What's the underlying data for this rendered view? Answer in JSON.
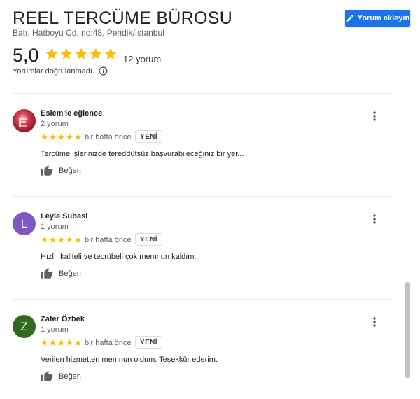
{
  "business": {
    "name": "REEL TERCÜME BÜROSU",
    "address": "Batı, Hatboyu Cd. no:48, Pendik/İstanbul",
    "write_review_label": "Yorum ekleyin",
    "rating": "5,0",
    "rating_value": 5,
    "review_count": "12 yorum",
    "unverified_note": "Yorumlar doğrulanmadı."
  },
  "colors": {
    "accent": "#1a73e8",
    "star": "#fbbc04",
    "avatar_leyla": "#7e57c2",
    "avatar_zafer": "#33691e"
  },
  "reviews": [
    {
      "name": "Eslem'le eğlence",
      "count": "2 yorum",
      "stars": 5,
      "time": "bir hafta önce",
      "badge": "YENİ",
      "text": "Tercüme işlerinizde tereddütsüz başvurabileceğiniz bir yer...",
      "like_label": "Beğen",
      "avatar_initial": ""
    },
    {
      "name": "Leyla Subasi",
      "count": "1 yorum",
      "stars": 5,
      "time": "bir hafta önce",
      "badge": "YENİ",
      "text": "Hızlı, kaliteli ve tecrübeli çok memnun kaldım.",
      "like_label": "Beğen",
      "avatar_initial": "L"
    },
    {
      "name": "Zafer Özbek",
      "count": "1 yorum",
      "stars": 5,
      "time": "bir hafta önce",
      "badge": "YENİ",
      "text": "Verilen hizmetten memnun oldum. Teşekkür ederim.",
      "like_label": "Beğen",
      "avatar_initial": "Z"
    }
  ]
}
